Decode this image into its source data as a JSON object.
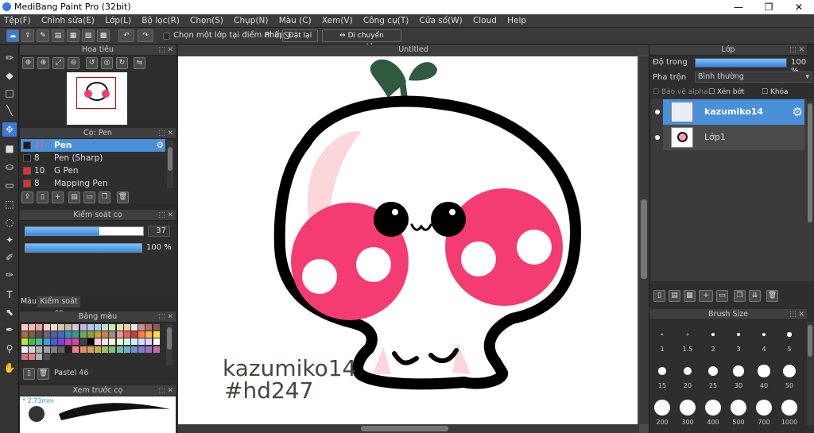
{
  "app": {
    "title": "MediBang Paint Pro (32bit)",
    "win_min": "—",
    "win_max": "❐",
    "win_close": "✕"
  },
  "menu": [
    "Tệp(F)",
    "Chỉnh sửa(E)",
    "Lớp(L)",
    "Bộ lọc(R)",
    "Chọn(S)",
    "Chụp(N)",
    "Màu (C)",
    "Xem(V)",
    "Công cụ(T)",
    "Cửa số(W)",
    "Cloud",
    "Help"
  ],
  "toolbar": {
    "select_one_layer": "Chọn một lớp tại điểm nhấp",
    "snap_label": "Phím",
    "reset_label": "Đặt lại",
    "move_label": "Di chuyển ngang/dọc"
  },
  "navigator": {
    "title": "Hoa tiêu"
  },
  "brush_panel": {
    "title": "Cọ: Pen",
    "brushes": [
      {
        "size": "37",
        "name": "Pen",
        "color": "#1e1e1e",
        "selected": true
      },
      {
        "size": "8",
        "name": "Pen (Sharp)",
        "color": "#1e1e1e",
        "selected": false
      },
      {
        "size": "10",
        "name": "G Pen",
        "color": "#e03030",
        "selected": false
      },
      {
        "size": "8",
        "name": "Mapping Pen",
        "color": "#e03030",
        "selected": false
      }
    ]
  },
  "brush_control": {
    "title": "Kiểm soát cọ",
    "size_value": "37",
    "size_fraction": 0.63,
    "opacity_value": "100 %",
    "opacity_fraction": 1.0
  },
  "color_tabs": {
    "color": "Màu",
    "brush_control": "Kiểm soát cọ"
  },
  "palette": {
    "title": "Bảng màu",
    "name": "Pastel 46"
  },
  "preview": {
    "title": "Xem trước cọ",
    "size": "* 2.73mm"
  },
  "canvas": {
    "title": "Untitled",
    "text_line1": "kazumiko14",
    "text_line2": "#hd247"
  },
  "layers_panel": {
    "title": "Lớp",
    "opacity_label": "Độ trong",
    "opacity_value": "100 %",
    "blend_label": "Pha trộn",
    "blend_value": "Bình thường",
    "alpha_protect": "Bảo vệ alpha",
    "clipping": "Xén bớt",
    "lock": "Khóa",
    "layers": [
      {
        "name": "kazumiko14",
        "selected": true
      },
      {
        "name": "Lớp1",
        "selected": false
      }
    ]
  },
  "brush_size_panel": {
    "title": "Brush Size",
    "sizes": [
      "1",
      "1.5",
      "2",
      "3",
      "4",
      "5",
      "15",
      "20",
      "25",
      "30",
      "40",
      "50",
      "200",
      "300",
      "400",
      "500",
      "700",
      "1000"
    ]
  },
  "colors": {
    "accent": "#4a90d9",
    "pink": "#f43b72",
    "stem": "#2f5a3f"
  }
}
